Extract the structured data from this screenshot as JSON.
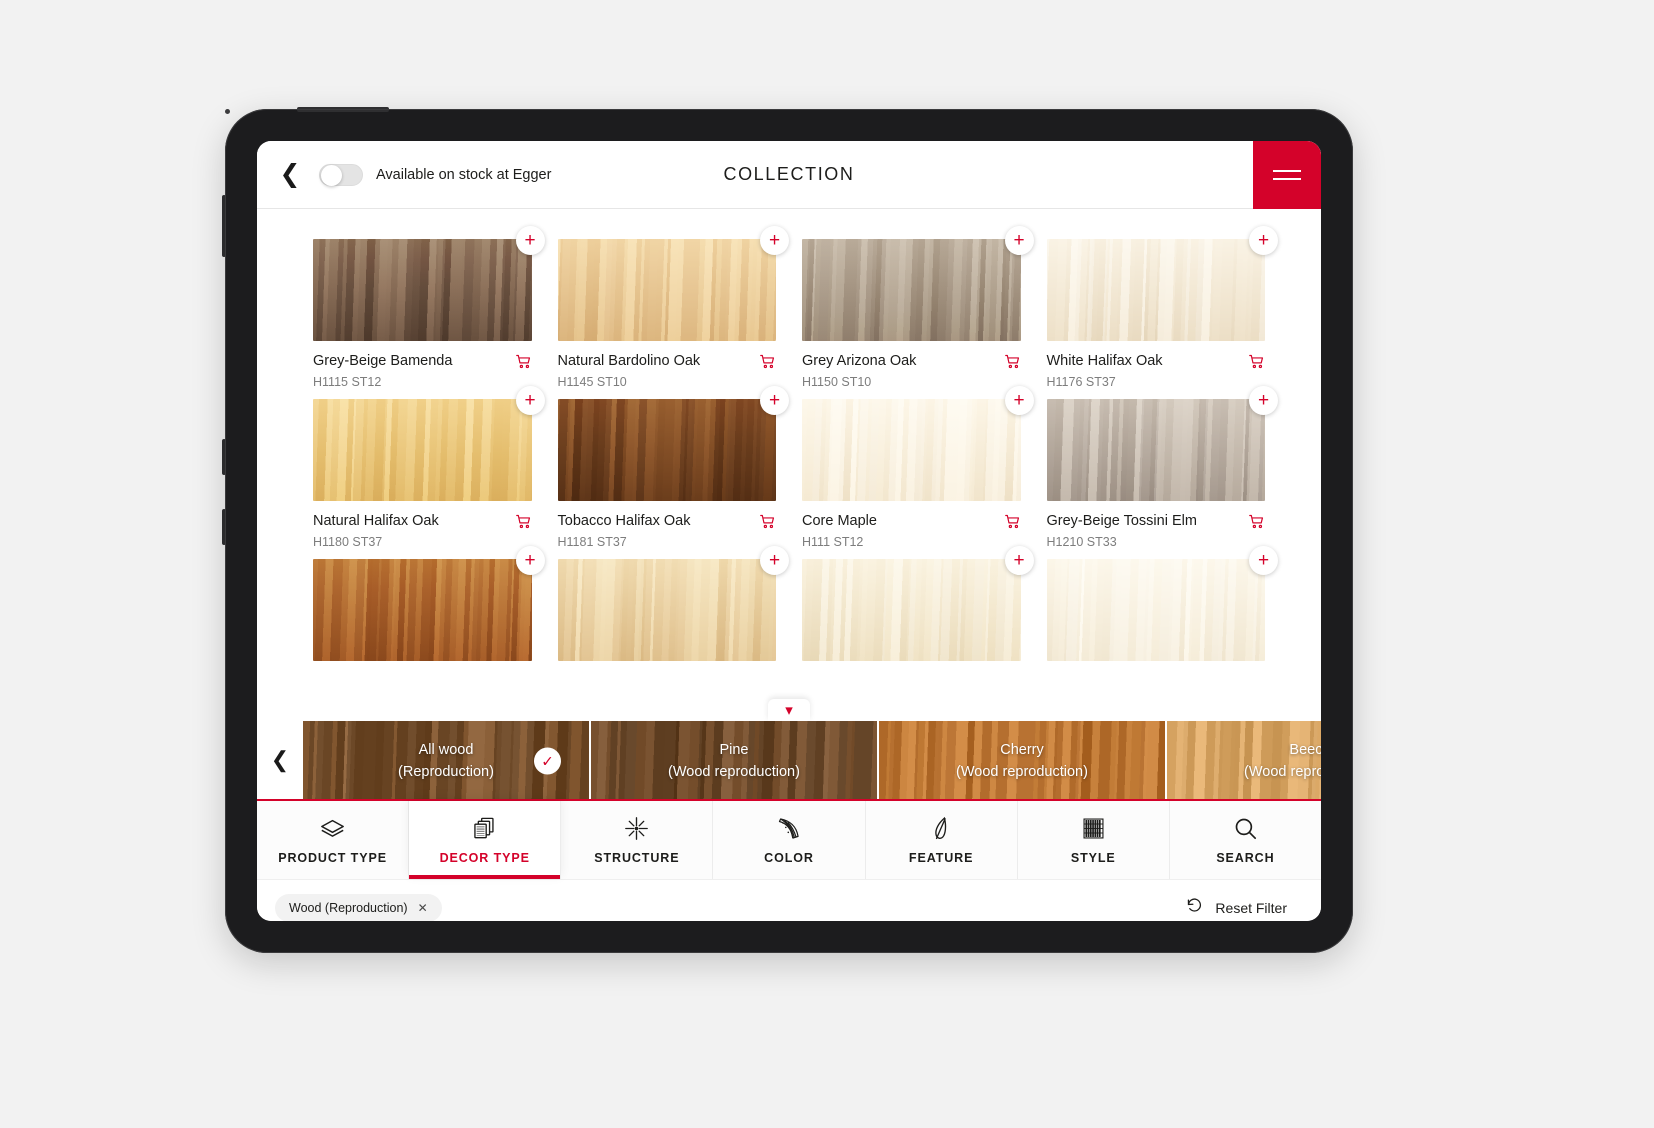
{
  "topbar": {
    "back_icon": "chevron-left-icon",
    "stock_toggle_label": "Available on stock at Egger",
    "stock_toggle_state": "off",
    "title": "COLLECTION",
    "menu_icon": "hamburger-menu-icon"
  },
  "colors": {
    "brand_red": "#d4022a",
    "text_primary": "#1d1d1b",
    "text_secondary": "#7d7d7d"
  },
  "products": [
    {
      "name": "Grey-Beige Bamenda",
      "code": "H1115 ST12",
      "add_icon": "plus-icon",
      "cart_icon": "shopping-cart-icon",
      "tone_a": "#8d7f72",
      "tone_b": "#6d5f54"
    },
    {
      "name": "Natural Bardolino Oak",
      "code": "H1145 ST10",
      "add_icon": "plus-icon",
      "cart_icon": "shopping-cart-icon",
      "tone_a": "#d8bb98",
      "tone_b": "#c0a283"
    },
    {
      "name": "Grey Arizona Oak",
      "code": "H1150 ST10",
      "add_icon": "plus-icon",
      "cart_icon": "shopping-cart-icon",
      "tone_a": "#a79e93",
      "tone_b": "#8b8279"
    },
    {
      "name": "White Halifax Oak",
      "code": "H1176 ST37",
      "add_icon": "plus-icon",
      "cart_icon": "shopping-cart-icon",
      "tone_a": "#e4d9c9",
      "tone_b": "#cfc0ab"
    },
    {
      "name": "Natural Halifax Oak",
      "code": "H1180 ST37",
      "add_icon": "plus-icon",
      "cart_icon": "shopping-cart-icon",
      "tone_a": "#d9b98d",
      "tone_b": "#c4a376"
    },
    {
      "name": "Tobacco Halifax Oak",
      "code": "H1181 ST37",
      "add_icon": "plus-icon",
      "cart_icon": "shopping-cart-icon",
      "tone_a": "#8a6c4c",
      "tone_b": "#6e5339"
    },
    {
      "name": "Core Maple",
      "code": "H111 ST12",
      "add_icon": "plus-icon",
      "cart_icon": "shopping-cart-icon",
      "tone_a": "#ecdfcd",
      "tone_b": "#dbcbb4"
    },
    {
      "name": "Grey-Beige Tossini Elm",
      "code": "H1210 ST33",
      "add_icon": "plus-icon",
      "cart_icon": "shopping-cart-icon",
      "tone_a": "#b4aca3",
      "tone_b": "#97908a"
    },
    {
      "name": "",
      "code": "",
      "add_icon": "plus-icon",
      "cart_icon": "shopping-cart-icon",
      "tone_a": "#a9825c",
      "tone_b": "#8d6844"
    },
    {
      "name": "",
      "code": "",
      "add_icon": "plus-icon",
      "cart_icon": "shopping-cart-icon",
      "tone_a": "#d8c2a2",
      "tone_b": "#c3a98a"
    },
    {
      "name": "",
      "code": "",
      "add_icon": "plus-icon",
      "cart_icon": "shopping-cart-icon",
      "tone_a": "#e5d9c5",
      "tone_b": "#d3c3a9"
    },
    {
      "name": "",
      "code": "",
      "add_icon": "plus-icon",
      "cart_icon": "shopping-cart-icon",
      "tone_a": "#ece2d2",
      "tone_b": "#dccfba"
    }
  ],
  "collapse_handle": {
    "icon": "chevron-down-icon"
  },
  "carousel": {
    "prev_icon": "chevron-left-icon",
    "items": [
      {
        "line1": "All wood",
        "line2": "(Reproduction)",
        "selected": true,
        "check_icon": "check-icon",
        "tone_a": "#8a5f38",
        "tone_b": "#6b4726"
      },
      {
        "line1": "Pine",
        "line2": "(Wood reproduction)",
        "selected": false,
        "check_icon": "check-icon",
        "tone_a": "#7d5634",
        "tone_b": "#5f3f22"
      },
      {
        "line1": "Cherry",
        "line2": "(Wood reproduction)",
        "selected": false,
        "check_icon": "check-icon",
        "tone_a": "#c8823d",
        "tone_b": "#b06a2a"
      },
      {
        "line1": "Beech",
        "line2": "(Wood reproduction)",
        "selected": false,
        "check_icon": "check-icon",
        "tone_a": "#e3b273",
        "tone_b": "#d3a05e"
      }
    ]
  },
  "tabs": [
    {
      "label": "PRODUCT TYPE",
      "icon": "layers-board-icon",
      "active": false
    },
    {
      "label": "DECOR TYPE",
      "icon": "decor-sheets-icon",
      "active": true
    },
    {
      "label": "STRUCTURE",
      "icon": "sparkle-star-icon",
      "active": false
    },
    {
      "label": "COLOR",
      "icon": "color-fan-icon",
      "active": false
    },
    {
      "label": "FEATURE",
      "icon": "feather-leaf-icon",
      "active": false
    },
    {
      "label": "STYLE",
      "icon": "grid-pattern-icon",
      "active": false
    },
    {
      "label": "SEARCH",
      "icon": "search-icon",
      "active": false
    }
  ],
  "chipbar": {
    "chips": [
      {
        "label": "Wood (Reproduction)",
        "remove_icon": "close-icon"
      }
    ],
    "reset": {
      "label": "Reset Filter",
      "icon": "reset-circular-arrow-icon"
    }
  }
}
